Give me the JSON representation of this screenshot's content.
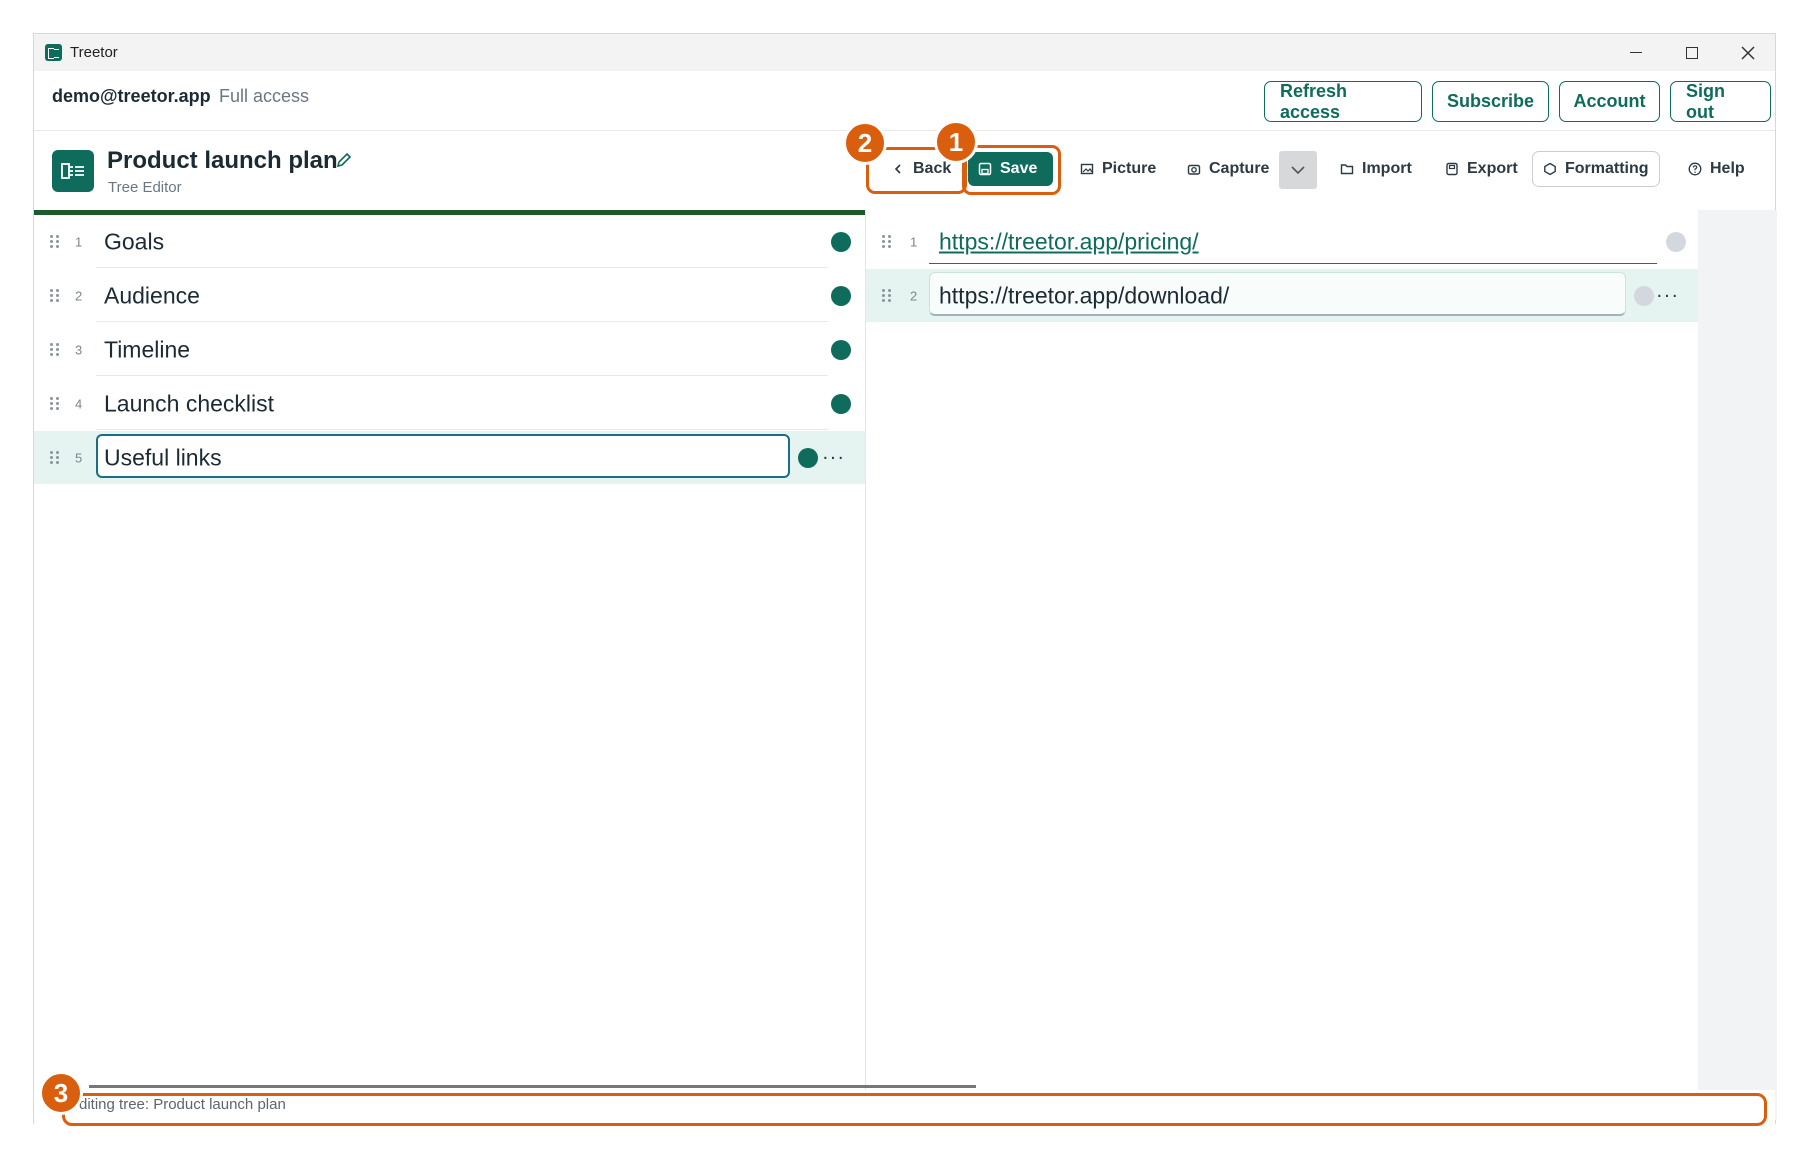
{
  "window": {
    "title": "Treetor"
  },
  "account": {
    "email": "demo@treetor.app",
    "access": "Full access",
    "buttons": [
      "Refresh access",
      "Subscribe",
      "Account",
      "Sign out"
    ]
  },
  "document": {
    "title": "Product launch plan",
    "subtitle": "Tree Editor",
    "icon_label": "⿸⇆"
  },
  "toolbar": {
    "back": "Back",
    "save": "Save",
    "picture": "Picture",
    "capture": "Capture",
    "import": "Import",
    "export": "Export",
    "formatting": "Formatting",
    "help": "Help"
  },
  "tree": {
    "items": [
      {
        "num": "1",
        "label": "Goals"
      },
      {
        "num": "2",
        "label": "Audience"
      },
      {
        "num": "3",
        "label": "Timeline"
      },
      {
        "num": "4",
        "label": "Launch checklist"
      },
      {
        "num": "5",
        "label": "Useful links",
        "selected": true
      }
    ]
  },
  "detail": {
    "items": [
      {
        "num": "1",
        "text": "https://treetor.app/pricing/"
      },
      {
        "num": "2",
        "text": "https://treetor.app/download/",
        "selected": true
      }
    ]
  },
  "status": {
    "text": "diting tree: Product launch plan"
  },
  "callouts": [
    "1",
    "2",
    "3"
  ],
  "colors": {
    "accent": "#0f6b5c",
    "callout": "#d95f0e",
    "selected_row": "#e6f4f1"
  }
}
